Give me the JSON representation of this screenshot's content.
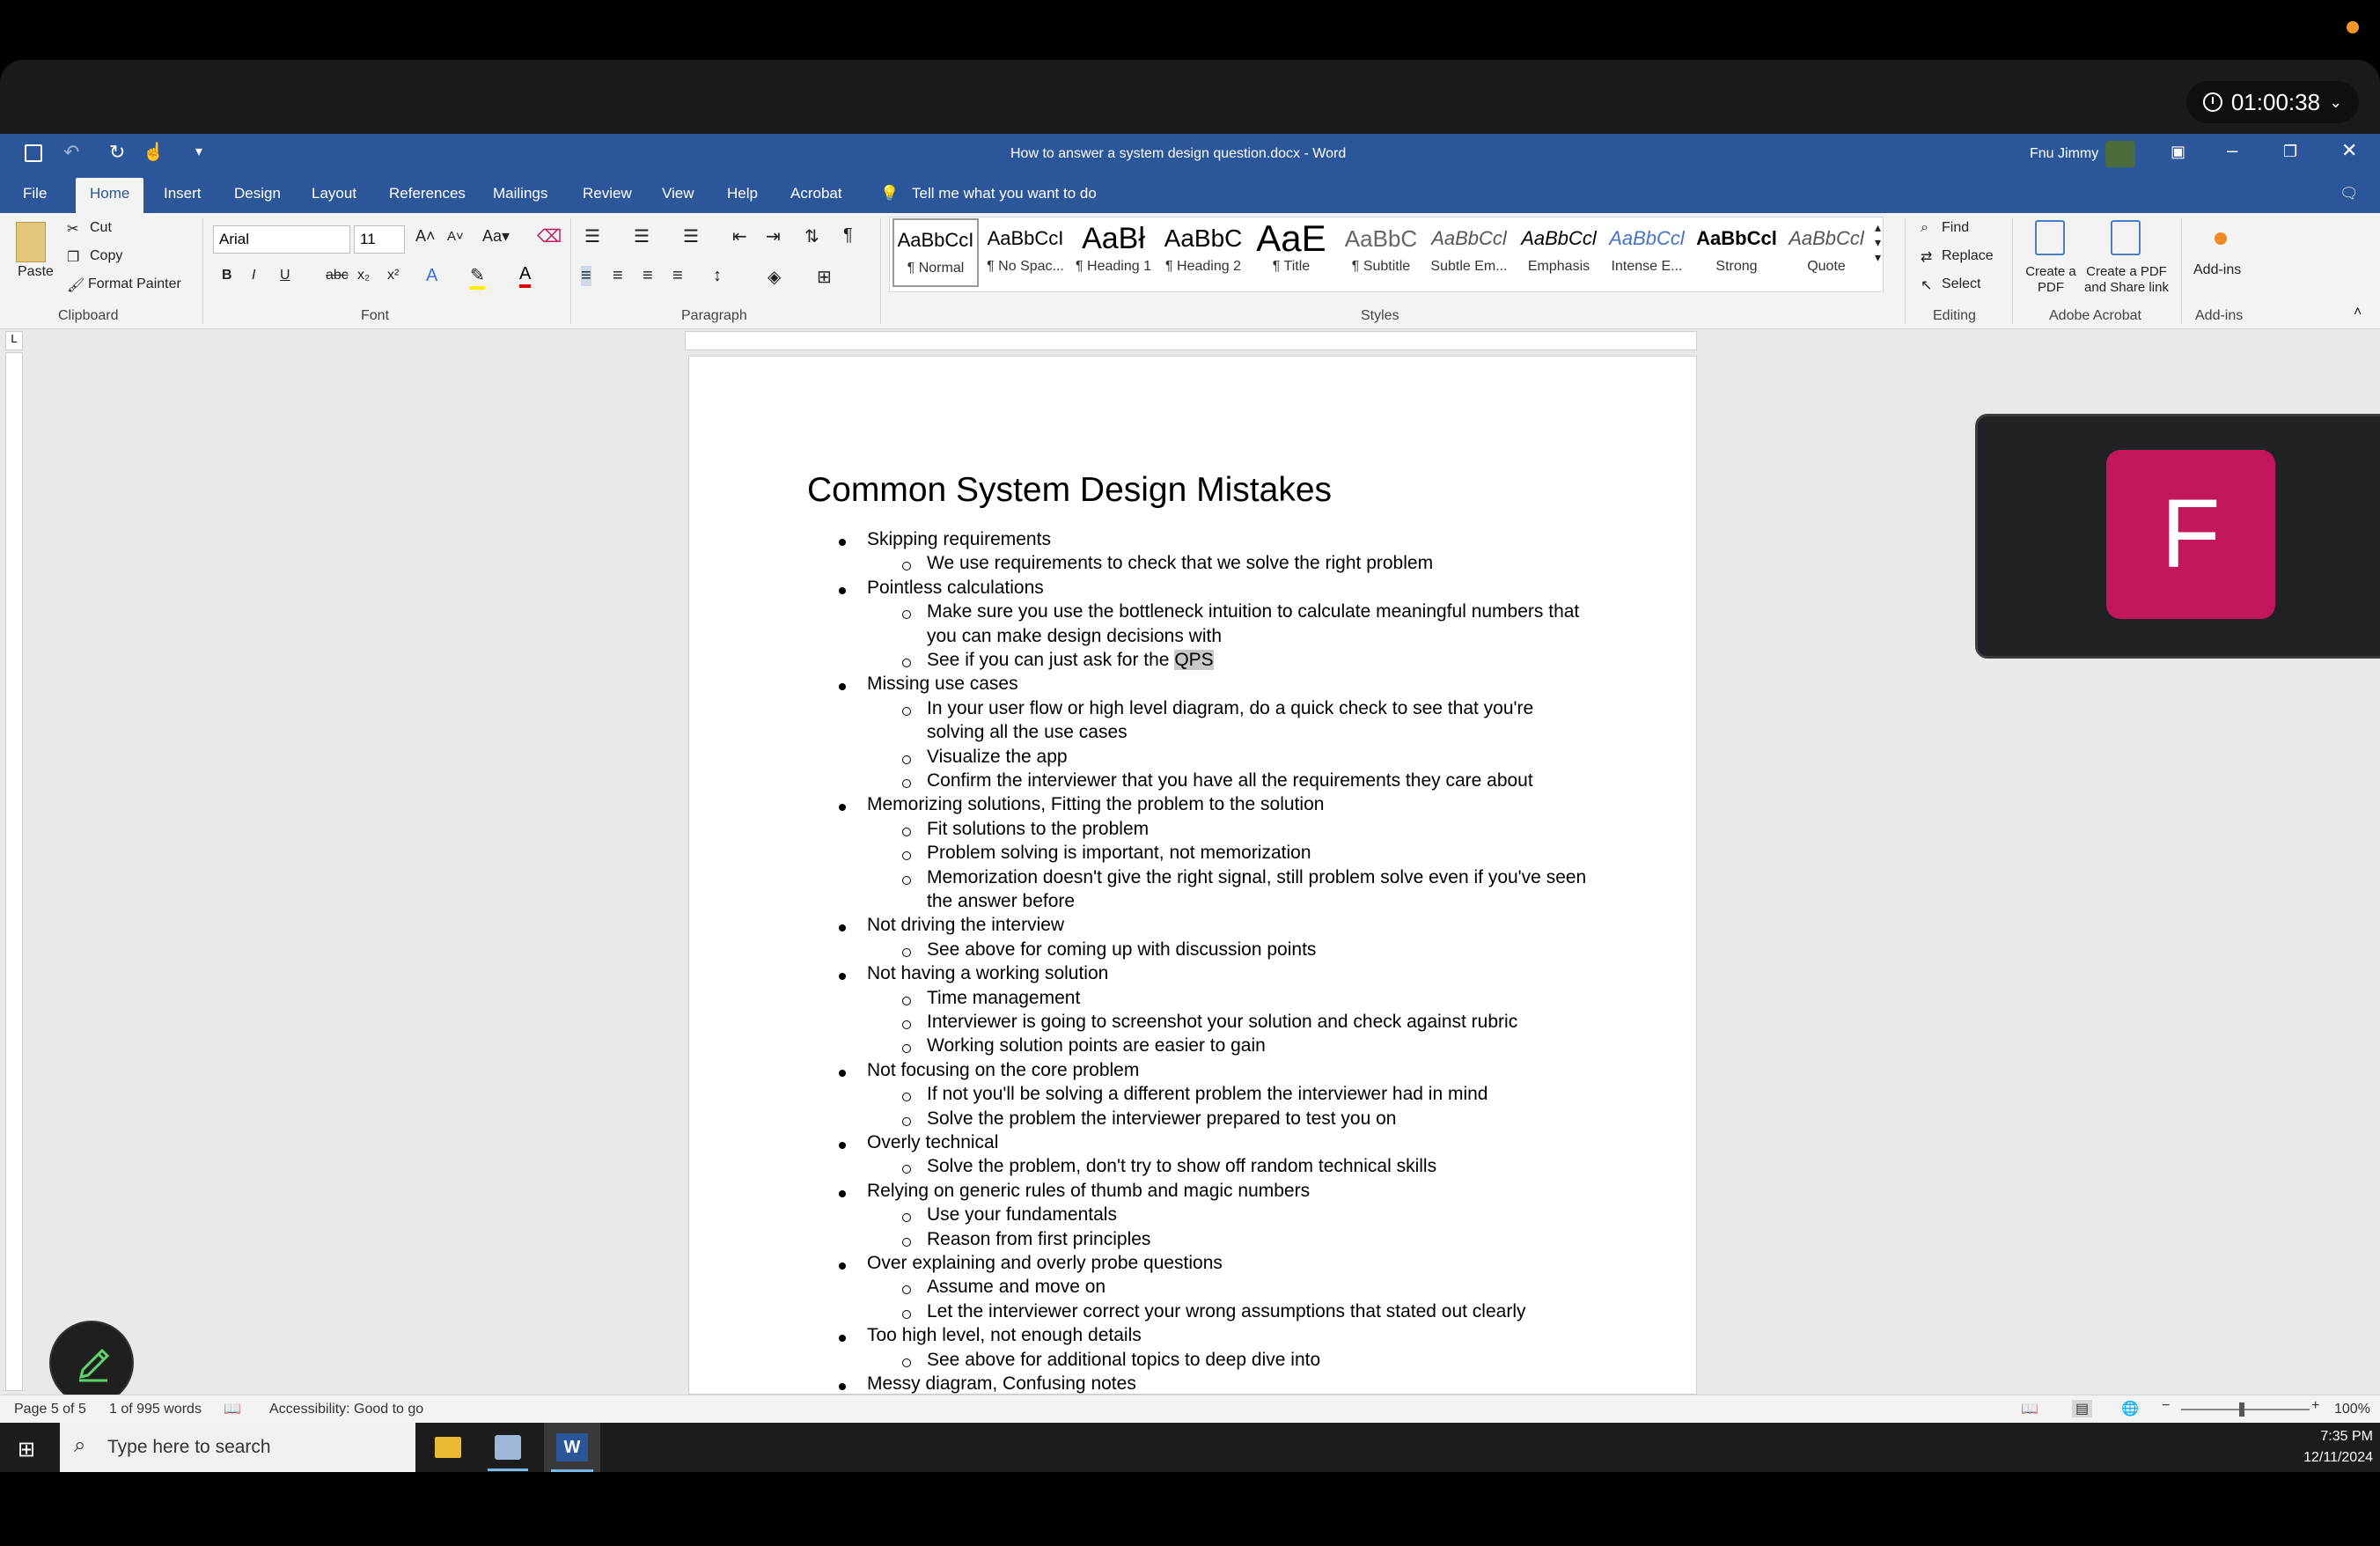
{
  "meeting": {
    "timer": "01:00:38",
    "participant_initial": "F"
  },
  "word": {
    "title": "How to answer a system design question.docx  -  Word",
    "user": "Fnu Jimmy",
    "tabs": [
      "File",
      "Home",
      "Insert",
      "Design",
      "Layout",
      "References",
      "Mailings",
      "Review",
      "View",
      "Help",
      "Acrobat"
    ],
    "tell_me": "Tell me what you want to do",
    "clipboard": {
      "paste": "Paste",
      "cut": "Cut",
      "copy": "Copy",
      "format_painter": "Format Painter",
      "label": "Clipboard"
    },
    "font": {
      "name": "Arial",
      "size": "11",
      "label": "Font"
    },
    "paragraph_label": "Paragraph",
    "styles": [
      {
        "sample": "AaBbCcI",
        "name": "¶ Normal"
      },
      {
        "sample": "AaBbCcI",
        "name": "¶ No Spac..."
      },
      {
        "sample": "AaBł",
        "name": "¶ Heading 1"
      },
      {
        "sample": "AaBbC",
        "name": "¶ Heading 2"
      },
      {
        "sample": "AaE",
        "name": "¶ Title"
      },
      {
        "sample": "AaBbC",
        "name": "¶ Subtitle"
      },
      {
        "sample": "AaBbCcl",
        "name": "Subtle Em..."
      },
      {
        "sample": "AaBbCcl",
        "name": "Emphasis"
      },
      {
        "sample": "AaBbCcl",
        "name": "Intense E..."
      },
      {
        "sample": "AaBbCcl",
        "name": "Strong"
      },
      {
        "sample": "AaBbCcl",
        "name": "Quote"
      }
    ],
    "styles_label": "Styles",
    "editing": {
      "find": "Find",
      "replace": "Replace",
      "select": "Select",
      "label": "Editing"
    },
    "acrobat": {
      "create_pdf": "Create a PDF",
      "create_share": "Create a PDF and Share link",
      "label": "Adobe Acrobat"
    },
    "addins": {
      "btn": "Add-ins",
      "label": "Add-ins"
    }
  },
  "document": {
    "heading": "Common System Design Mistakes",
    "lines": [
      {
        "lvl": 1,
        "text": "Skipping requirements"
      },
      {
        "lvl": 2,
        "text": "We use requirements to check that we solve the right problem"
      },
      {
        "lvl": 1,
        "text": "Pointless calculations"
      },
      {
        "lvl": 2,
        "text": "Make sure you use the bottleneck intuition to calculate meaningful numbers that"
      },
      {
        "lvl": 3,
        "text": "you can make design decisions with"
      },
      {
        "lvl": 2,
        "text": "See if you can just ask for the ",
        "hl": "QPS"
      },
      {
        "lvl": 1,
        "text": "Missing use cases"
      },
      {
        "lvl": 2,
        "text": "In your user flow or high level diagram, do a quick check to see that you're"
      },
      {
        "lvl": 3,
        "text": "solving all the use cases"
      },
      {
        "lvl": 2,
        "text": "Visualize the app"
      },
      {
        "lvl": 2,
        "text": "Confirm the interviewer that you have all the requirements they care about"
      },
      {
        "lvl": 1,
        "text": "Memorizing solutions, Fitting the problem to the solution"
      },
      {
        "lvl": 2,
        "text": "Fit solutions to the problem"
      },
      {
        "lvl": 2,
        "text": "Problem solving is important, not memorization"
      },
      {
        "lvl": 2,
        "text": "Memorization doesn't give the right signal, still problem solve even if you've seen"
      },
      {
        "lvl": 3,
        "text": "the answer before"
      },
      {
        "lvl": 1,
        "text": "Not driving the interview"
      },
      {
        "lvl": 2,
        "text": "See above for coming up with discussion points"
      },
      {
        "lvl": 1,
        "text": "Not having a working solution"
      },
      {
        "lvl": 2,
        "text": "Time management"
      },
      {
        "lvl": 2,
        "text": "Interviewer is going to screenshot your solution and check against rubric"
      },
      {
        "lvl": 2,
        "text": "Working solution points are easier to gain"
      },
      {
        "lvl": 1,
        "text": "Not focusing on the core problem"
      },
      {
        "lvl": 2,
        "text": "If not you'll be solving a different problem the interviewer had in mind"
      },
      {
        "lvl": 2,
        "text": "Solve the problem the interviewer prepared to test you on"
      },
      {
        "lvl": 1,
        "text": "Overly technical"
      },
      {
        "lvl": 2,
        "text": "Solve the problem, don't try to show off random technical skills"
      },
      {
        "lvl": 1,
        "text": "Relying on generic rules of thumb and magic numbers"
      },
      {
        "lvl": 2,
        "text": "Use your fundamentals"
      },
      {
        "lvl": 2,
        "text": "Reason from first principles"
      },
      {
        "lvl": 1,
        "text": "Over explaining and overly probe questions"
      },
      {
        "lvl": 2,
        "text": "Assume and move on"
      },
      {
        "lvl": 2,
        "text": "Let the interviewer correct your wrong assumptions that stated out clearly"
      },
      {
        "lvl": 1,
        "text": "Too high level, not enough details"
      },
      {
        "lvl": 2,
        "text": "See above for additional topics to deep dive into"
      },
      {
        "lvl": 1,
        "text": "Messy diagram, Confusing notes"
      }
    ]
  },
  "status": {
    "page": "Page 5 of 5",
    "words": "1 of 995 words",
    "accessibility": "Accessibility: Good to go",
    "zoom": "100%"
  },
  "taskbar": {
    "search_placeholder": "Type here to search",
    "time": "7:35 PM",
    "date": "12/11/2024"
  }
}
